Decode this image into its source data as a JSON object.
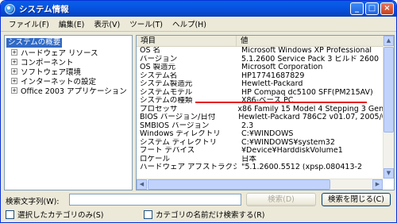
{
  "window": {
    "title": "システム情報"
  },
  "title_buttons": {
    "minimize": "_",
    "maximize": "□",
    "close": "×"
  },
  "menu": [
    "ファイル(F)",
    "編集(E)",
    "表示(V)",
    "ツール(T)",
    "ヘルプ(H)"
  ],
  "tree": {
    "root": "システムの概要",
    "children": [
      "ハードウェア リソース",
      "コンポーネント",
      "ソフトウェア環境",
      "インターネットの設定",
      "Office 2003 アプリケーション"
    ]
  },
  "list": {
    "headers": [
      "項目",
      "値"
    ],
    "rows": [
      [
        "OS 名",
        "Microsoft Windows XP Professional"
      ],
      [
        "バージョン",
        "5.1.2600 Service Pack 3 ビルド 2600"
      ],
      [
        "OS 製造元",
        "Microsoft Corporation"
      ],
      [
        "システム名",
        "HP17741687829"
      ],
      [
        "システム製造元",
        "Hewlett-Packard"
      ],
      [
        "システムモデル",
        "HP Compaq dc5100 SFF(PM215AV)"
      ],
      [
        "システムの種類",
        "X86-ベース PC"
      ],
      [
        "プロセッサ",
        "x86 Family 15 Model 4 Stepping 3 Genuine"
      ],
      [
        "BIOS バージョン/日付",
        "Hewlett-Packard 786C2 v01.07, 2005/08/2"
      ],
      [
        "SMBIOS バージョン",
        "2.3"
      ],
      [
        "Windows ディレクトリ",
        "C:¥WINDOWS"
      ],
      [
        "システム ディレクトリ",
        "C:¥WINDOWS¥system32"
      ],
      [
        "ブート デバイス",
        "¥Device¥HarddiskVolume1"
      ],
      [
        "ロケール",
        "日本"
      ],
      [
        "ハードウェア アブストラクション",
        "\"5.1.2600.5512 (xpsp.080413-2"
      ]
    ]
  },
  "search": {
    "label": "検索文字列(W):",
    "value": "",
    "find_button": "検索(D)",
    "close_button": "検索を閉じる(C)",
    "check_selected": "選択したカテゴリのみ(S)",
    "check_names": "カテゴリの名前だけ検索する(R)"
  },
  "colors": {
    "selection": "#316ac5",
    "annotation_line": "#e8141e",
    "titlebar": "#0655e5"
  }
}
